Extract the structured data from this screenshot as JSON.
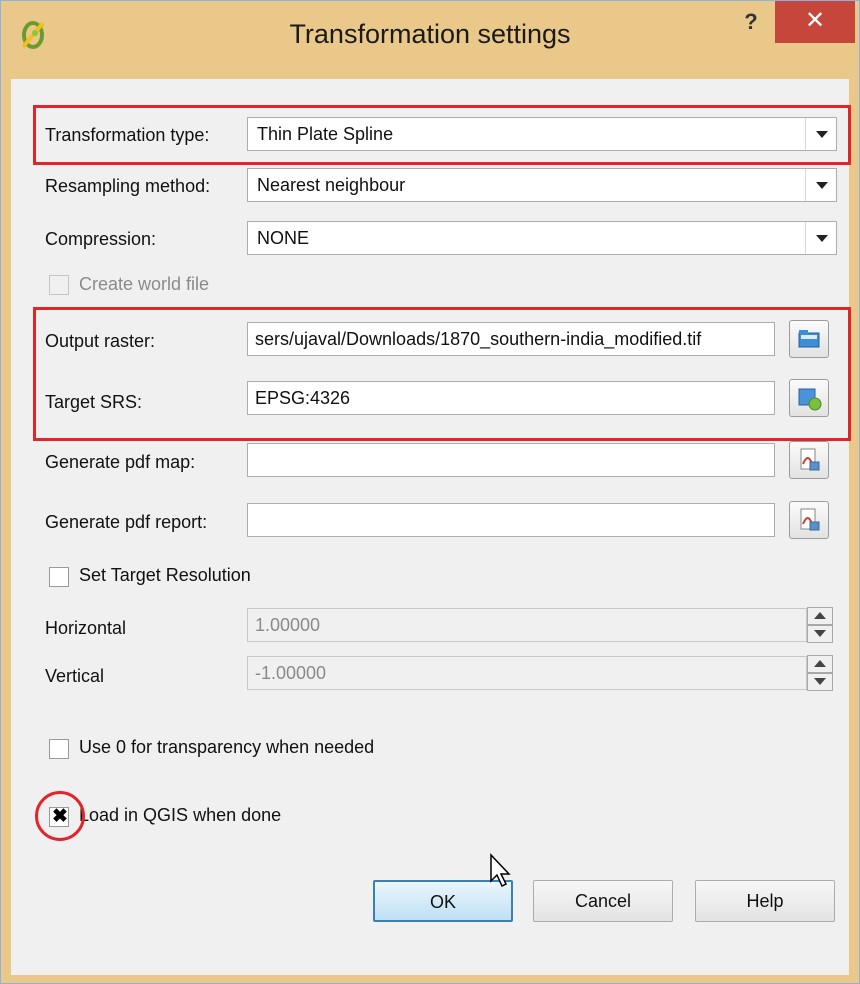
{
  "window": {
    "title": "Transformation settings",
    "help": "?",
    "close": "✕",
    "app_icon": "qgis-logo-icon"
  },
  "form": {
    "transformation_type": {
      "label": "Transformation type:",
      "value": "Thin Plate Spline"
    },
    "resampling_method": {
      "label": "Resampling method:",
      "value": "Nearest neighbour"
    },
    "compression": {
      "label": "Compression:",
      "value": "NONE"
    },
    "create_world_file": {
      "label": "Create world file",
      "checked": false,
      "disabled": true
    },
    "output_raster": {
      "label": "Output raster:",
      "value": "sers/ujaval/Downloads/1870_southern-india_modified.tif",
      "icon": "folder-browse-icon"
    },
    "target_srs": {
      "label": "Target SRS:",
      "value": "EPSG:4326",
      "icon": "projection-select-icon"
    },
    "generate_pdf_map": {
      "label": "Generate pdf map:",
      "value": "",
      "icon": "pdf-icon"
    },
    "generate_pdf_report": {
      "label": "Generate pdf report:",
      "value": "",
      "icon": "pdf-icon"
    },
    "set_target_resolution": {
      "label": "Set Target Resolution",
      "checked": false
    },
    "horizontal": {
      "label": "Horizontal",
      "value": "1.00000"
    },
    "vertical": {
      "label": "Vertical",
      "value": "-1.00000"
    },
    "use_zero_transparency": {
      "label": "Use 0 for transparency when needed",
      "checked": false
    },
    "load_in_qgis": {
      "label": "Load in QGIS when done",
      "checked": true,
      "mark": "✖"
    }
  },
  "buttons": {
    "ok": "OK",
    "cancel": "Cancel",
    "help": "Help"
  },
  "colors": {
    "highlight": "#e0262b",
    "close_bg": "#c7463c",
    "title_bg": "#e9c88a"
  }
}
